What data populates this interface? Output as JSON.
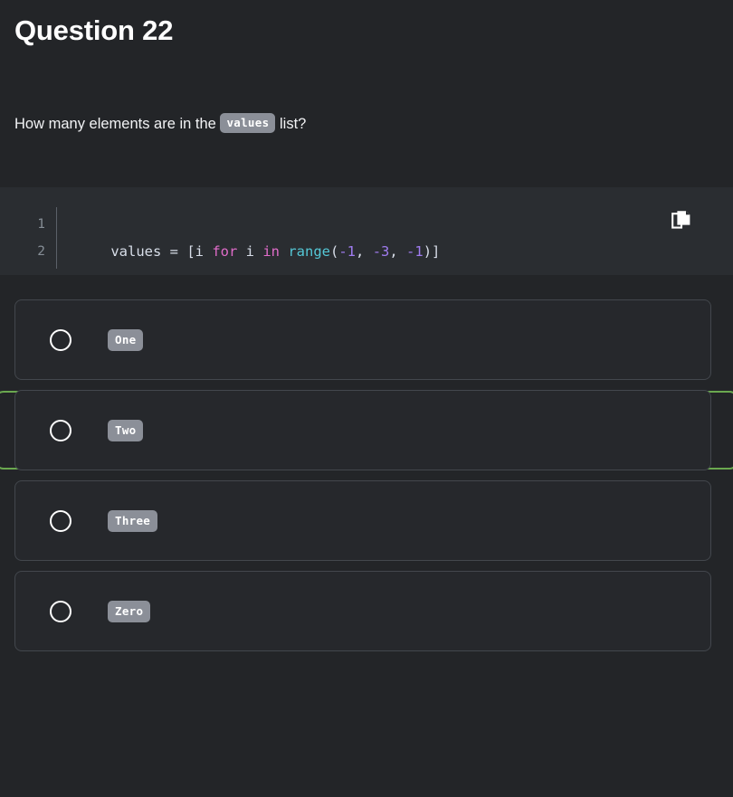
{
  "header": {
    "title": "Question 22"
  },
  "question": {
    "text_before": "How many elements are in the ",
    "inline_code": "values",
    "text_after": " list?"
  },
  "code_block": {
    "language": "python",
    "line_numbers": [
      "1",
      "2"
    ],
    "copy_icon": "copy-icon",
    "copy_label": "Copy",
    "tokens": [
      {
        "text": "values = [i ",
        "type": "plain"
      },
      {
        "text": "for",
        "type": "keyword"
      },
      {
        "text": " i ",
        "type": "plain"
      },
      {
        "text": "in",
        "type": "keyword"
      },
      {
        "text": " ",
        "type": "plain"
      },
      {
        "text": "range",
        "type": "function"
      },
      {
        "text": "(",
        "type": "plain"
      },
      {
        "text": "-1",
        "type": "number"
      },
      {
        "text": ", ",
        "type": "plain"
      },
      {
        "text": "-3",
        "type": "number"
      },
      {
        "text": ", ",
        "type": "plain"
      },
      {
        "text": "-1",
        "type": "number"
      },
      {
        "text": ")]",
        "type": "plain"
      }
    ],
    "full_code": "values = [i for i in range(-1, -3, -1)]"
  },
  "options": [
    {
      "label": "One",
      "selected": false
    },
    {
      "label": "Two",
      "selected": false
    },
    {
      "label": "Three",
      "selected": false
    },
    {
      "label": "Zero",
      "selected": false
    }
  ],
  "highlight": {
    "target_option_index": 1,
    "border_color": "#6aa84f"
  },
  "colors": {
    "page_background": "#232528",
    "code_background": "#2a2d31",
    "option_background": "#26282c",
    "option_border": "#43474d",
    "badge_background": "#8b8f98",
    "text_primary": "#f2f3f5",
    "line_number": "#868e96",
    "token_plain": "#d8dee9",
    "token_keyword": "#e06cc9",
    "token_function": "#54c7d6",
    "token_number": "#a07cf0",
    "highlight_green": "#6aa84f"
  }
}
